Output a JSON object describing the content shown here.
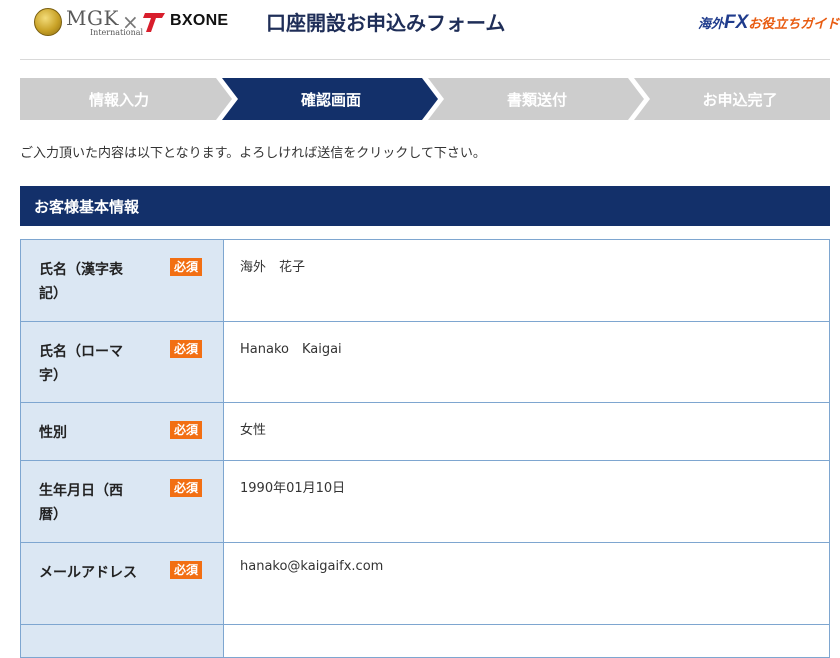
{
  "header": {
    "mgk_logo": {
      "name": "MGK",
      "sub": "International"
    },
    "cross": "×",
    "bx_logo": "BXONE",
    "form_title": "口座開設お申込みフォーム",
    "guide_logo": {
      "part1": "海外",
      "part2": "FX",
      "part3": "お役立ちガイド"
    }
  },
  "steps": [
    {
      "label": "情報入力",
      "active": false
    },
    {
      "label": "確認画面",
      "active": true
    },
    {
      "label": "書類送付",
      "active": false
    },
    {
      "label": "お申込完了",
      "active": false
    }
  ],
  "intro_text": "ご入力頂いた内容は以下となります。よろしければ送信をクリックして下さい。",
  "section": {
    "title": "お客様基本情報"
  },
  "form": {
    "required_label": "必須",
    "rows": [
      {
        "label": "氏名（漢字表記）",
        "value": "海外　花子"
      },
      {
        "label": "氏名（ローマ字）",
        "value": "Hanako　Kaigai"
      },
      {
        "label": "性別",
        "value": "女性"
      },
      {
        "label": "生年月日（西暦）",
        "value": "1990年01月10日"
      },
      {
        "label": "メールアドレス",
        "value": "hanako@kaigaifx.com"
      },
      {
        "label": "",
        "value": ""
      }
    ]
  },
  "colors": {
    "navy": "#13306a",
    "inactive_step": "#cdcdcd",
    "required": "#f26f13",
    "label_bg": "#dbe7f3",
    "border": "#7ea6d0"
  }
}
